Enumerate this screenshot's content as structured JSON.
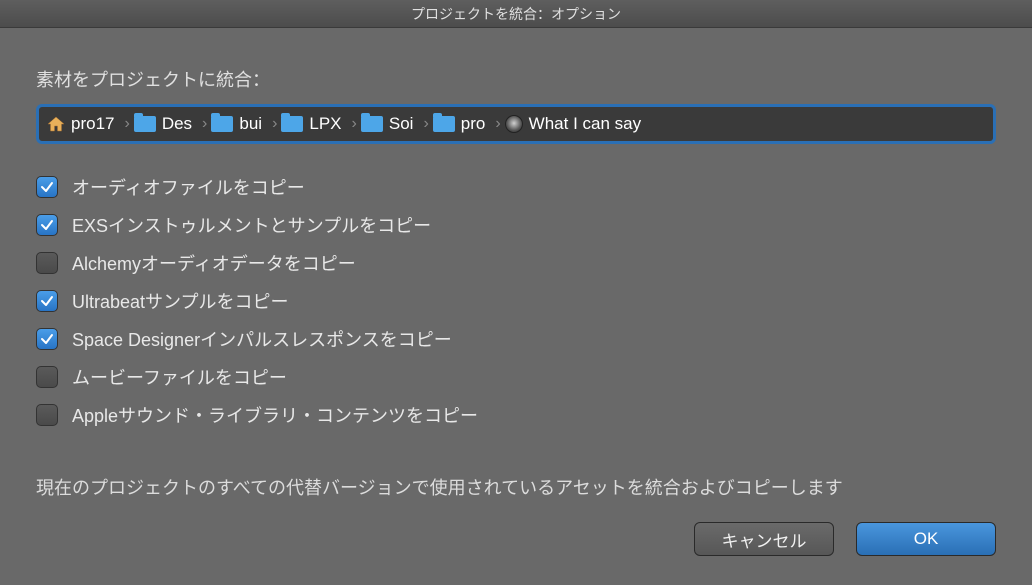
{
  "title": "プロジェクトを統合：オプション",
  "section_label": "素材をプロジェクトに統合：",
  "breadcrumb": [
    {
      "icon": "home",
      "label": "pro17"
    },
    {
      "icon": "folder",
      "label": "Des"
    },
    {
      "icon": "folder",
      "label": "bui"
    },
    {
      "icon": "folder",
      "label": "LPX"
    },
    {
      "icon": "folder",
      "label": "Soi"
    },
    {
      "icon": "folder",
      "label": "pro"
    },
    {
      "icon": "doc",
      "label": "What I can say"
    }
  ],
  "checks": [
    {
      "checked": true,
      "label": "オーディオファイルをコピー"
    },
    {
      "checked": true,
      "label": "EXSインストゥルメントとサンプルをコピー"
    },
    {
      "checked": false,
      "label": "Alchemyオーディオデータをコピー"
    },
    {
      "checked": true,
      "label": "Ultrabeatサンプルをコピー"
    },
    {
      "checked": true,
      "label": "Space Designerインパルスレスポンスをコピー"
    },
    {
      "checked": false,
      "label": "ムービーファイルをコピー"
    },
    {
      "checked": false,
      "label": "Appleサウンド・ライブラリ・コンテンツをコピー"
    }
  ],
  "description": "現在のプロジェクトのすべての代替バージョンで使用されているアセットを統合およびコピーします",
  "buttons": {
    "cancel": "キャンセル",
    "ok": "OK"
  }
}
